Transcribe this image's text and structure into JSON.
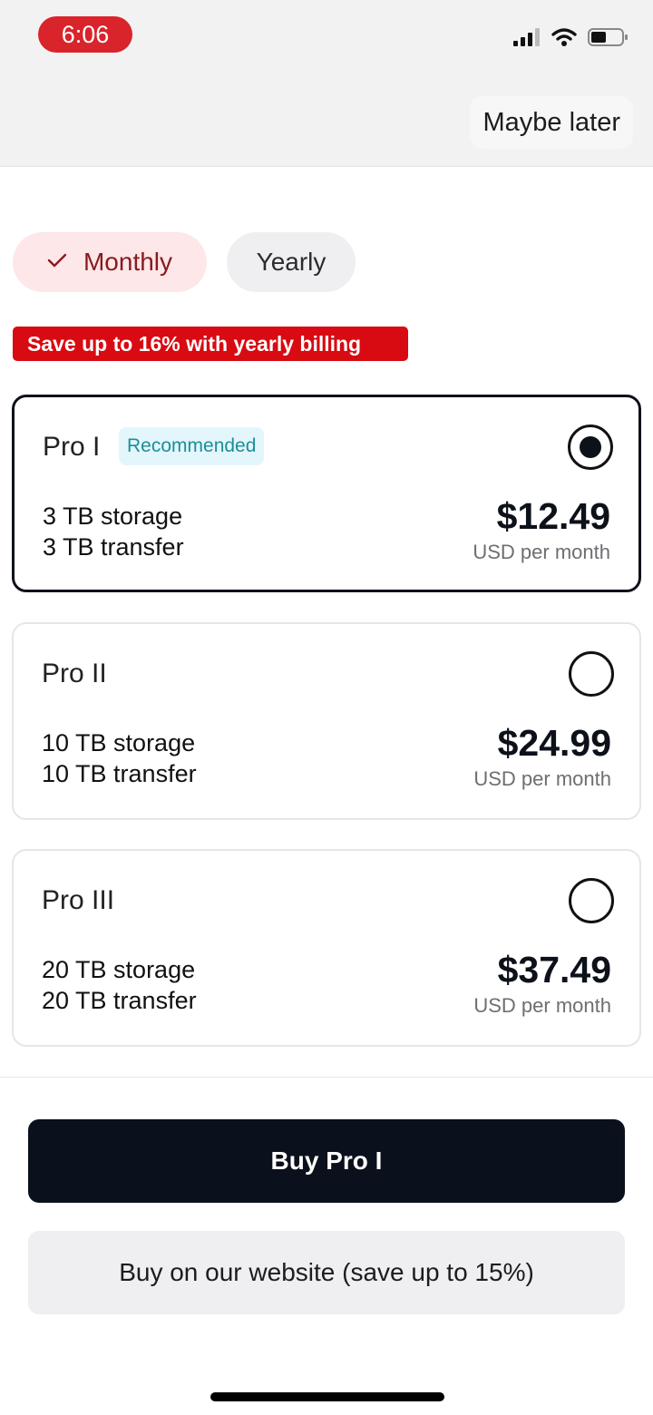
{
  "status_bar": {
    "time": "6:06",
    "icons": [
      "cellular-signal-icon",
      "wifi-icon",
      "battery-icon"
    ]
  },
  "header": {
    "maybe_later": "Maybe later"
  },
  "billing_toggle": {
    "monthly_label": "Monthly",
    "yearly_label": "Yearly",
    "selected": "Monthly",
    "check_icon": "checkmark-icon"
  },
  "save_banner": "Save up to 16% with yearly billing",
  "plans": [
    {
      "name": "Pro I",
      "badge": "Recommended",
      "storage": "3 TB storage",
      "transfer": "3 TB transfer",
      "price": "$12.49",
      "price_sub": "USD per month",
      "selected": true
    },
    {
      "name": "Pro II",
      "storage": "10 TB storage",
      "transfer": "10 TB transfer",
      "price": "$24.99",
      "price_sub": "USD per month",
      "selected": false
    },
    {
      "name": "Pro III",
      "storage": "20 TB storage",
      "transfer": "20 TB transfer",
      "price": "$37.49",
      "price_sub": "USD per month",
      "selected": false
    }
  ],
  "actions": {
    "buy_label": "Buy Pro I",
    "website_label": "Buy on our website (save up to 15%)"
  },
  "colors": {
    "accent_red": "#d80a12",
    "primary_dark": "#0a111c",
    "badge_teal": "#1d8e97"
  }
}
